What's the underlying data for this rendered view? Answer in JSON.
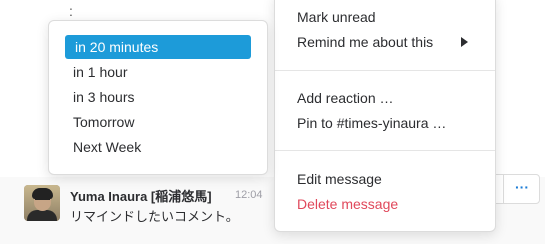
{
  "message": {
    "sender": "Yuma Inaura [稲浦悠馬]",
    "time": "12:04",
    "text": "リマインドしたいコメント。"
  },
  "top_ellipsis": ":",
  "actions": {
    "more_label": "···"
  },
  "main_menu": {
    "items": [
      {
        "label": "Mark unread"
      },
      {
        "label": "Remind me about this"
      },
      {
        "label": "Add reaction …"
      },
      {
        "label": "Pin to #times-yinaura …"
      },
      {
        "label": "Edit message"
      },
      {
        "label": "Delete message"
      }
    ]
  },
  "remind_menu": {
    "items": [
      {
        "label": "in 20 minutes",
        "highlighted": true
      },
      {
        "label": "in 1 hour"
      },
      {
        "label": "in 3 hours"
      },
      {
        "label": "Tomorrow"
      },
      {
        "label": "Next Week"
      }
    ]
  },
  "colors": {
    "highlight": "#1d9bd9",
    "danger": "#e0485b",
    "link": "#1a7bd6"
  }
}
